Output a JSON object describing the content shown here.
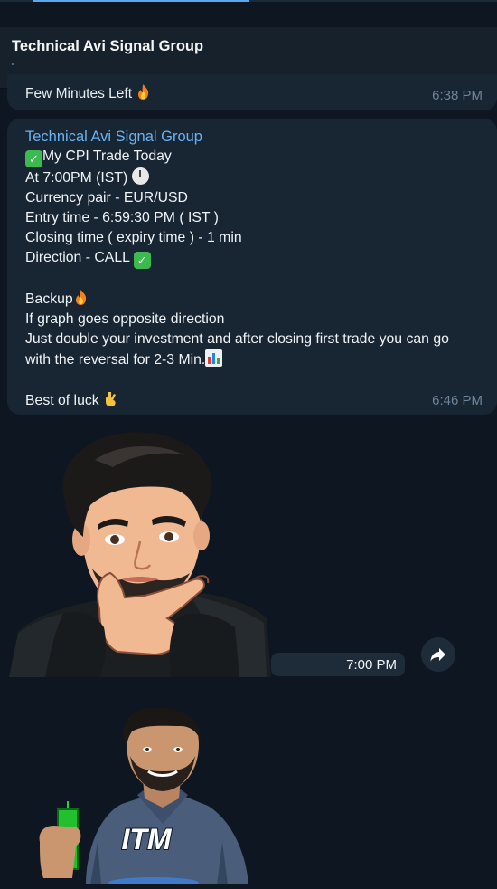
{
  "header": {
    "title": "Technical Avi Signal Group"
  },
  "messages": {
    "prev": {
      "text": "Few Minutes Left",
      "time": "6:38 PM"
    },
    "main": {
      "sender": "Technical Avi Signal Group",
      "line1": "My CPI Trade Today",
      "line2": "At 7:00PM (IST)",
      "line3": "Currency pair - EUR/USD",
      "line4": "Entry time - 6:59:30 PM ( IST )",
      "line5": "Closing time ( expiry time ) - 1 min",
      "line6": "Direction - CALL",
      "line7": "Backup",
      "line8": "If graph goes opposite direction",
      "line9": "Just double your investment and after closing first trade you can go with the reversal for 2-3 Min.",
      "line10": "Best of luck",
      "time": "6:46 PM"
    },
    "sticker": {
      "time": "7:00 PM"
    },
    "sticker2": {
      "label": "ITM"
    }
  },
  "icons": {
    "fire": "fire-icon",
    "check": "check-mark-icon",
    "clock": "clock-icon",
    "chart": "bar-chart-icon",
    "luck": "crossed-fingers-icon",
    "forward": "forward-arrow-icon"
  },
  "colors": {
    "background": "#0e1621",
    "bubble": "#182533",
    "header": "#17212b",
    "sender": "#6ab3f3",
    "time": "#6d8499",
    "check": "#3cba4f"
  }
}
